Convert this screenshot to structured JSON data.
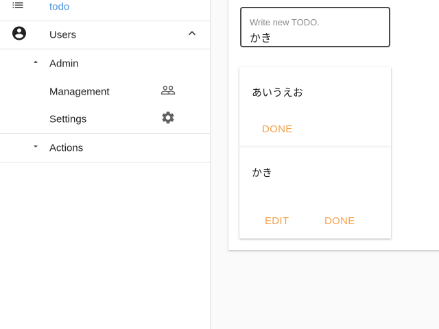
{
  "sidebar": {
    "todo_label": "todo",
    "users_label": "Users",
    "admin_label": "Admin",
    "management_label": "Management",
    "settings_label": "Settings",
    "actions_label": "Actions",
    "icons": {
      "todo": "list-icon",
      "users": "account-circle-icon",
      "users_toggle": "chevron-up-icon",
      "admin_toggle": "triangle-up-icon",
      "management": "people-outline-icon",
      "settings": "gear-icon",
      "actions_toggle": "triangle-down-icon"
    }
  },
  "main": {
    "input": {
      "label": "Write new TODO.",
      "value": "かき"
    },
    "todos": [
      {
        "text": "あいうえお",
        "actions": [
          "DONE"
        ]
      },
      {
        "text": "かき",
        "actions": [
          "EDIT",
          "DONE"
        ]
      }
    ]
  },
  "colors": {
    "accent_link": "#4a90e2",
    "action_button": "#f5a04a",
    "divider": "#e0e0e0",
    "icon": "#616161"
  }
}
